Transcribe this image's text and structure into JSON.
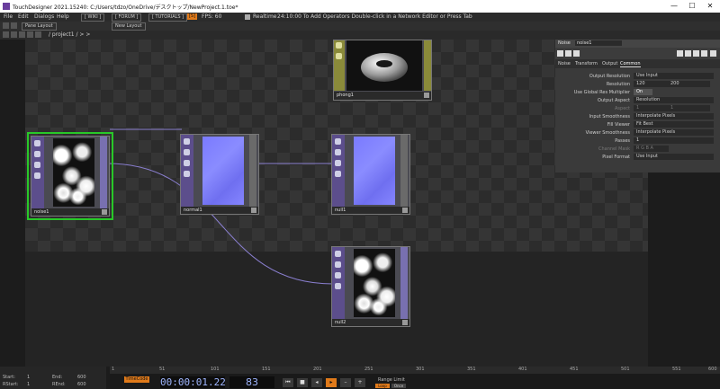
{
  "window": {
    "title": "TouchDesigner 2021.15240: C:/Users/tdzo/OneDrive/デスクトップ/NewProject.1.toe*",
    "minimize": "—",
    "maximize": "☐",
    "close": "✕"
  },
  "menu": {
    "items": [
      "File",
      "Edit",
      "Dialogs",
      "Help"
    ],
    "buttons": [
      "[ WIKI ]",
      "[ FORUM ]",
      "[ TUTORIALS ]"
    ],
    "stop": "[S]",
    "fps": "FPS: 60",
    "realtime": "Realtime",
    "hint": "24:10:00 To Add Operators Double-click in a Network Editor or Press Tab"
  },
  "panebar": {
    "pane_layout": "Pane Layout",
    "new_layout": "New Layout"
  },
  "path": "/ project1 / > >",
  "nodes": {
    "noise1": "noise1",
    "normal1": "normal1",
    "null1": "null1",
    "null2": "null2",
    "phong1": "phong1"
  },
  "params": {
    "op_type": "Noise",
    "op_name": "noise1",
    "tabs": [
      "Noise",
      "Transform",
      "Output",
      "Common"
    ],
    "rows": [
      {
        "label": "Output Resolution",
        "value": "Use Input"
      },
      {
        "label": "Resolution",
        "value": "120",
        "value2": "200"
      },
      {
        "label": "Use Global Res Multiplier",
        "value": "On"
      },
      {
        "label": "Output Aspect",
        "value": "Resolution"
      },
      {
        "label": "Aspect",
        "value": "1",
        "value2": "1"
      },
      {
        "label": "Input Smoothness",
        "value": "Interpolate Pixels"
      },
      {
        "label": "Fill Viewer",
        "value": "Fit Best"
      },
      {
        "label": "Viewer Smoothness",
        "value": "Interpolate Pixels"
      },
      {
        "label": "Passes",
        "value": "1"
      },
      {
        "label": "Channel Mask",
        "value": "R G B A"
      },
      {
        "label": "Pixel Format",
        "value": "Use Input"
      }
    ]
  },
  "timeline": {
    "start_label": "Start:",
    "start": "1",
    "end_label": "End:",
    "end": "600",
    "rstart_label": "RStart:",
    "rstart": "1",
    "rend_label": "REnd:",
    "rend": "600",
    "ticks": [
      "1",
      "51",
      "101",
      "151",
      "201",
      "251",
      "301",
      "351",
      "401",
      "451",
      "501",
      "551",
      "600"
    ],
    "timecode_btn": "TimeCode",
    "timecode": "00:00:01.22",
    "frame": "83",
    "range_limit": "Range Limit",
    "loop": "Loop",
    "once": "Once",
    "beats": "Beats",
    "transport": [
      "⏮",
      "■",
      "◂",
      "▸",
      "–",
      "+"
    ]
  }
}
